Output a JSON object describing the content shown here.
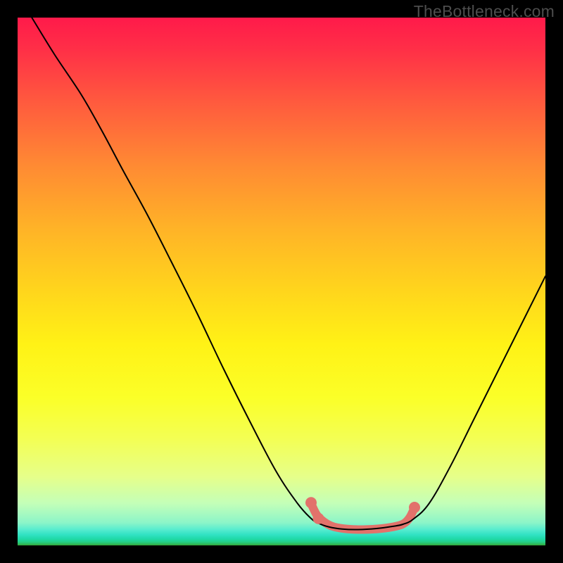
{
  "watermark": "TheBottleneck.com",
  "chart_data": {
    "type": "line",
    "title": "",
    "xlabel": "",
    "ylabel": "",
    "xlim": [
      0,
      100
    ],
    "ylim": [
      0,
      100
    ],
    "grid": false,
    "series": [
      {
        "name": "bottleneck-curve",
        "color": "#000000",
        "stroke_width": 2,
        "points": [
          {
            "x": 2.7,
            "y": 100.0
          },
          {
            "x": 7.0,
            "y": 93.0
          },
          {
            "x": 12.0,
            "y": 85.5
          },
          {
            "x": 16.0,
            "y": 78.5
          },
          {
            "x": 20.0,
            "y": 71.0
          },
          {
            "x": 24.5,
            "y": 62.8
          },
          {
            "x": 29.0,
            "y": 54.0
          },
          {
            "x": 34.0,
            "y": 44.0
          },
          {
            "x": 39.0,
            "y": 33.5
          },
          {
            "x": 44.0,
            "y": 23.5
          },
          {
            "x": 49.0,
            "y": 14.0
          },
          {
            "x": 53.0,
            "y": 8.0
          },
          {
            "x": 55.5,
            "y": 5.2
          },
          {
            "x": 57.0,
            "y": 4.2
          },
          {
            "x": 59.0,
            "y": 3.5
          },
          {
            "x": 61.5,
            "y": 3.1
          },
          {
            "x": 64.5,
            "y": 3.0
          },
          {
            "x": 68.0,
            "y": 3.2
          },
          {
            "x": 71.0,
            "y": 3.6
          },
          {
            "x": 73.0,
            "y": 4.0
          },
          {
            "x": 75.0,
            "y": 5.0
          },
          {
            "x": 78.0,
            "y": 8.0
          },
          {
            "x": 82.0,
            "y": 15.0
          },
          {
            "x": 86.5,
            "y": 24.0
          },
          {
            "x": 91.0,
            "y": 33.0
          },
          {
            "x": 95.5,
            "y": 42.0
          },
          {
            "x": 100.0,
            "y": 51.0
          }
        ]
      },
      {
        "name": "highlight-safe-zone",
        "color": "#e2726b",
        "stroke_width": 12,
        "points": [
          {
            "x": 55.8,
            "y": 7.5
          },
          {
            "x": 56.6,
            "y": 5.9
          },
          {
            "x": 57.5,
            "y": 4.9
          },
          {
            "x": 58.6,
            "y": 4.1
          },
          {
            "x": 60.0,
            "y": 3.5
          },
          {
            "x": 62.5,
            "y": 3.1
          },
          {
            "x": 65.5,
            "y": 3.0
          },
          {
            "x": 69.0,
            "y": 3.2
          },
          {
            "x": 72.0,
            "y": 3.7
          },
          {
            "x": 73.4,
            "y": 4.3
          },
          {
            "x": 74.3,
            "y": 5.3
          },
          {
            "x": 75.0,
            "y": 6.7
          }
        ]
      }
    ],
    "markers": [
      {
        "series": "highlight-safe-zone",
        "x": 55.6,
        "y": 8.1,
        "r": 8,
        "color": "#e2726b"
      },
      {
        "series": "highlight-safe-zone",
        "x": 57.0,
        "y": 5.1,
        "r": 8,
        "color": "#e2726b"
      },
      {
        "series": "highlight-safe-zone",
        "x": 75.2,
        "y": 7.2,
        "r": 8,
        "color": "#e2726b"
      }
    ]
  }
}
